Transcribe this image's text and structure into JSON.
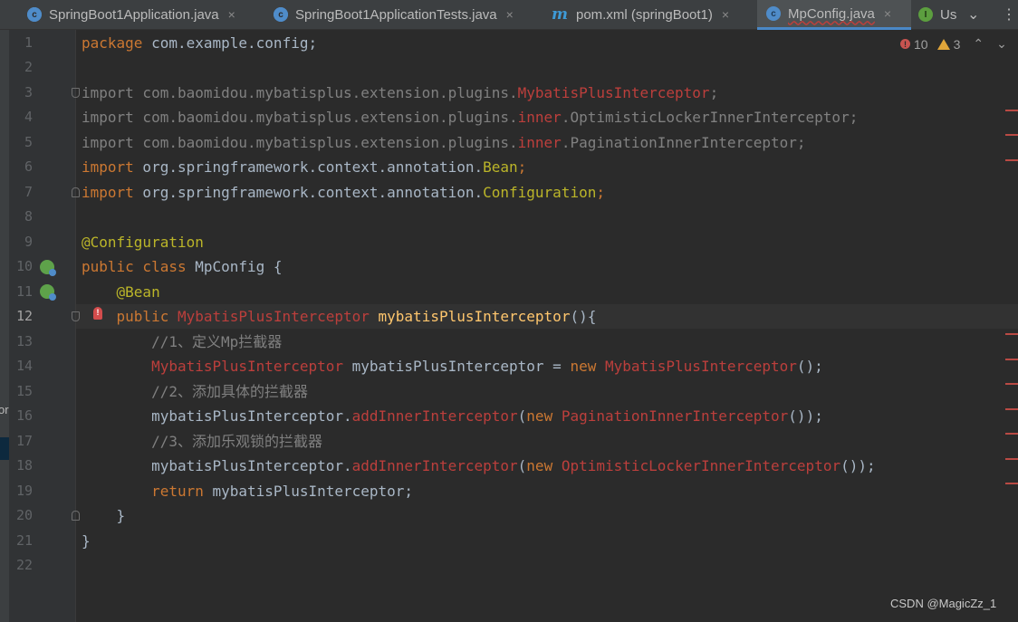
{
  "tabs": [
    {
      "label": "SpringBoot1Application.java",
      "icon": "spring-class-icon"
    },
    {
      "label": "SpringBoot1ApplicationTests.java",
      "icon": "spring-class-icon"
    },
    {
      "label": "pom.xml (springBoot1)",
      "icon": "maven-icon"
    },
    {
      "label": "MpConfig.java",
      "icon": "class-icon",
      "active": true
    },
    {
      "label": "Us",
      "icon": "interface-icon"
    }
  ],
  "tab_close_glyph": "×",
  "tab_controls": {
    "dropdown": "⌄",
    "more": "⋮"
  },
  "left_strip_char": "or",
  "inspections": {
    "errors": "10",
    "warnings": "3",
    "up": "⌃",
    "down": "⌄"
  },
  "line_numbers": [
    "1",
    "2",
    "3",
    "4",
    "5",
    "6",
    "7",
    "8",
    "9",
    "10",
    "11",
    "12",
    "13",
    "14",
    "15",
    "16",
    "17",
    "18",
    "19",
    "20",
    "21",
    "22"
  ],
  "code": {
    "l1": {
      "kw": "package",
      "rest": " com.example.config;"
    },
    "l3": {
      "kw": "import",
      "pkg": " com.baomidou.mybatisplus.extension.plugins.",
      "cls": "MybatisPlusInterceptor",
      "end": ";"
    },
    "l4": {
      "kw": "import",
      "pkg": " com.baomidou.mybatisplus.extension.plugins.",
      "sub": "inner",
      "rest": ".OptimisticLockerInnerInterceptor;"
    },
    "l5": {
      "kw": "import",
      "pkg": " com.baomidou.mybatisplus.extension.plugins.",
      "sub": "inner",
      "rest": ".PaginationInnerInterceptor;"
    },
    "l6": {
      "kw": "import",
      "pkg": " org.springframework.context.annotation.",
      "cls": "Bean",
      "end": ";"
    },
    "l7": {
      "kw": "import",
      "pkg": " org.springframework.context.annotation.",
      "cls": "Configuration",
      "end": ";"
    },
    "l9": {
      "ann": "@Configuration"
    },
    "l10": {
      "kw1": "public",
      "kw2": " class",
      "rest": " MpConfig {"
    },
    "l11": {
      "ann": "@Bean"
    },
    "l12": {
      "kw": "public",
      "type": " MybatisPlusInterceptor",
      "fn": " mybatisPlusInterceptor",
      "rest": "(){"
    },
    "l13": {
      "cm": "//1、定义Mp拦截器"
    },
    "l14": {
      "type": "MybatisPlusInterceptor",
      "var": " mybatisPlusInterceptor = ",
      "kw": "new",
      "type2": " MybatisPlusInterceptor",
      "rest": "();"
    },
    "l15": {
      "cm": "//2、添加具体的拦截器"
    },
    "l16": {
      "var": "mybatisPlusInterceptor.",
      "m": "addInnerInterceptor",
      "p": "(",
      "kw": "new",
      "type": " PaginationInnerInterceptor",
      "rest": "());"
    },
    "l17": {
      "cm": "//3、添加乐观锁的拦截器"
    },
    "l18": {
      "var": "mybatisPlusInterceptor.",
      "m": "addInnerInterceptor",
      "p": "(",
      "kw": "new",
      "type": " OptimisticLockerInnerInterceptor",
      "rest": "());"
    },
    "l19": {
      "kw": "return",
      "rest": " mybatisPlusInterceptor;"
    },
    "l20": {
      "rest": "}"
    },
    "l21": {
      "rest": "}"
    }
  },
  "watermark": "CSDN @MagicZz_1",
  "colors": {
    "keyword": "#cc7832",
    "error": "#bc3f3c",
    "annotation": "#bbb529",
    "method": "#ffc66d",
    "comment": "#808080",
    "text": "#a9b7c6"
  }
}
